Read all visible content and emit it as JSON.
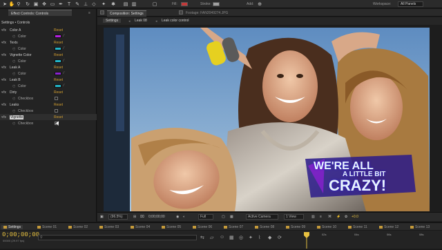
{
  "toolbar": {
    "fill_label": "Fill:",
    "stroke_label": "Stroke:",
    "add_label": "Add:",
    "workspace_label": "Workspace:",
    "workspace_value": "All Panels"
  },
  "effect_controls": {
    "tab_label": "Effect Controls: Controls",
    "breadcrumb": "Settings • Controls",
    "effects": [
      {
        "name": "Color A",
        "reset": "Reset",
        "sub": "Color",
        "sub_type": "color",
        "color": "#b61fe0"
      },
      {
        "name": "Texts",
        "reset": "Reset",
        "sub": "Color",
        "sub_type": "color",
        "color": "#22b5c8"
      },
      {
        "name": "Vignette Color",
        "reset": "Reset",
        "sub": "Color",
        "sub_type": "color",
        "color": "#22b5c8"
      },
      {
        "name": "Leak A",
        "reset": "Reset",
        "sub": "Color",
        "sub_type": "color",
        "color": "#8a23d0"
      },
      {
        "name": "Leak B",
        "reset": "Reset",
        "sub": "Color",
        "sub_type": "color",
        "color": "#22b5c8"
      },
      {
        "name": "Dirty",
        "reset": "Reset",
        "sub": "Checkbox",
        "sub_type": "checkbox"
      },
      {
        "name": "Leaks",
        "reset": "Reset",
        "sub": "Checkbox",
        "sub_type": "checkbox"
      },
      {
        "name": "Vignette",
        "reset": "Reset",
        "sub": "Checkbox",
        "sub_type": "checkbox"
      }
    ]
  },
  "composition": {
    "tab_label": "Composition: Settings",
    "footage_label": "Footage: FAN2049274.JPG",
    "subtabs": [
      "Settings",
      "Leak 08",
      "Leak color control"
    ],
    "overlay_line1": "WE'RE ALL",
    "overlay_line2": "A LITTLE BIT",
    "overlay_line3": "CRAZY!"
  },
  "viewer_bar": {
    "zoom": "(96.5%)",
    "timecode": "0;00;00;00",
    "resolution": "Full",
    "camera": "Active Camera",
    "view": "1 View",
    "exposure": "+0.0"
  },
  "timeline": {
    "tabs": [
      "Settings",
      "Scene 01",
      "Scene 02",
      "Scene 03",
      "Scene 04",
      "Scene 05",
      "Scene 06",
      "Scene 07",
      "Scene 08",
      "Scene 09",
      "Scene 10",
      "Scene 11",
      "Scene 12",
      "Scene 13"
    ],
    "timecode": "0;00;00;00",
    "timecode_sub": "00000 (29.97 fps)",
    "ruler_ticks": [
      "02s",
      "04s",
      "06s",
      "08s"
    ]
  },
  "colors": {
    "accent_orange": "#d4a030",
    "timecode_yellow": "#e6c040"
  }
}
